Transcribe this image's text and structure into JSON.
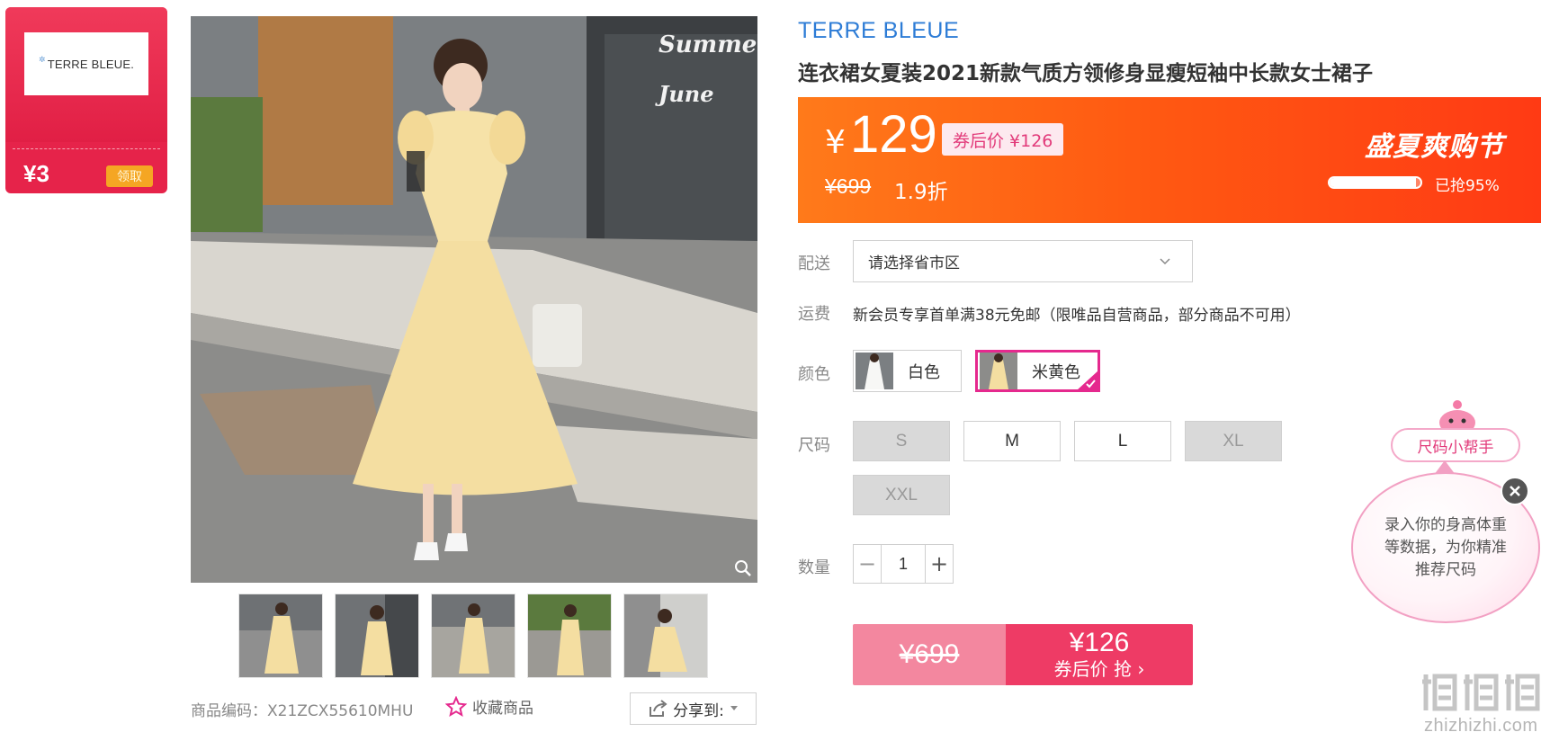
{
  "coupon": {
    "brand_logo_text": "TERRE BLEUE.",
    "amount": "¥3",
    "claim_label": "领取"
  },
  "gallery": {
    "thumbnail_count": 5,
    "image_text": "Summer June"
  },
  "product": {
    "brand": "TERRE BLEUE",
    "title": "连衣裙女夏装2021新款气质方领修身显瘦短袖中长款女士裙子",
    "sku_label": "商品编码：X21ZCX55610MHU",
    "favorite_label": "收藏商品",
    "share_label": "分享到:"
  },
  "price": {
    "currency": "¥",
    "current": "129",
    "after_coupon_label": "券后价 ¥126",
    "original": "¥699",
    "discount": "1.9折",
    "promo_title": "盛夏爽购节",
    "sold_percent": 95,
    "sold_label": "已抢95%"
  },
  "delivery": {
    "label": "配送",
    "placeholder": "请选择省市区"
  },
  "shipping": {
    "label": "运费",
    "text": "新会员专享首单满38元免邮（限唯品自营商品，部分商品不可用）"
  },
  "color": {
    "label": "颜色",
    "options": [
      {
        "name": "白色",
        "selected": false
      },
      {
        "name": "米黄色",
        "selected": true
      }
    ]
  },
  "size": {
    "label": "尺码",
    "options": [
      {
        "name": "S",
        "available": false
      },
      {
        "name": "M",
        "available": true
      },
      {
        "name": "L",
        "available": true
      },
      {
        "name": "XL",
        "available": false
      },
      {
        "name": "XXL",
        "available": false
      }
    ]
  },
  "quantity": {
    "label": "数量",
    "value": "1",
    "minus": "−",
    "plus": "+"
  },
  "buy": {
    "original": "¥699",
    "price": "¥126",
    "cta": "券后价 抢 ›"
  },
  "size_helper": {
    "title": "尺码小帮手",
    "message": "录入你的身高体重等数据，为你精准推荐尺码"
  },
  "watermark": {
    "site": "zhizhizhi.com"
  },
  "colors": {
    "accent_pink": "#e5298e",
    "price_orange": "#ff5a12",
    "buy_red": "#ee3b65",
    "brand_blue": "#2d7cd6"
  }
}
